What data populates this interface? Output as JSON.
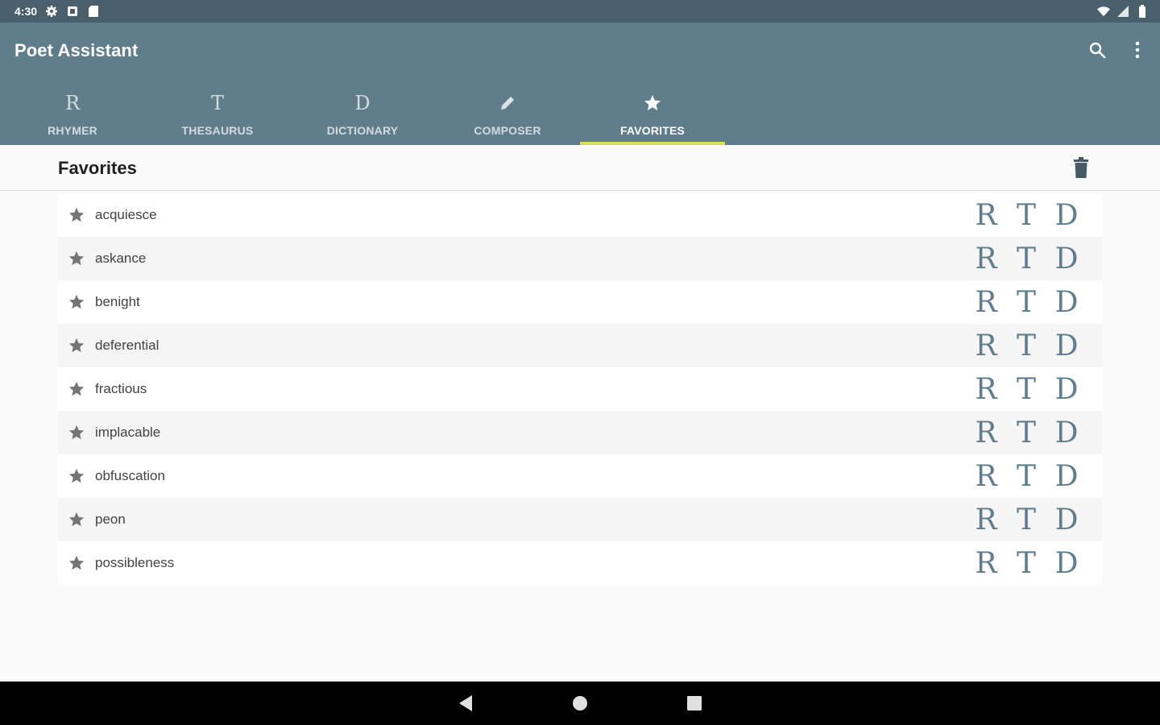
{
  "status_bar": {
    "time": "4:30",
    "icons": [
      "settings-icon",
      "notification-icon",
      "sd-card-icon",
      "wifi-icon",
      "signal-icon",
      "battery-icon"
    ]
  },
  "app_bar": {
    "title": "Poet Assistant",
    "actions": [
      "search-icon",
      "overflow-menu-icon"
    ],
    "color": "#607d8b"
  },
  "tabs": [
    {
      "icon_text": "R",
      "label": "RHYMER",
      "active": false
    },
    {
      "icon_text": "T",
      "label": "THESAURUS",
      "active": false
    },
    {
      "icon_text": "D",
      "label": "DICTIONARY",
      "active": false
    },
    {
      "icon_name": "pencil-icon",
      "label": "COMPOSER",
      "active": false
    },
    {
      "icon_name": "star-icon",
      "label": "FAVORITES",
      "active": true
    }
  ],
  "tab_indicator_color": "#d4e157",
  "favorites": {
    "title": "Favorites",
    "clear_icon": "trash-icon",
    "action_letters": {
      "rhymer": "R",
      "thesaurus": "T",
      "dictionary": "D"
    },
    "words": [
      "acquiesce",
      "askance",
      "benight",
      "deferential",
      "fractious",
      "implacable",
      "obfuscation",
      "peon",
      "possibleness"
    ]
  },
  "nav_bar": {
    "buttons": [
      "back-icon",
      "home-icon",
      "recents-icon"
    ]
  }
}
